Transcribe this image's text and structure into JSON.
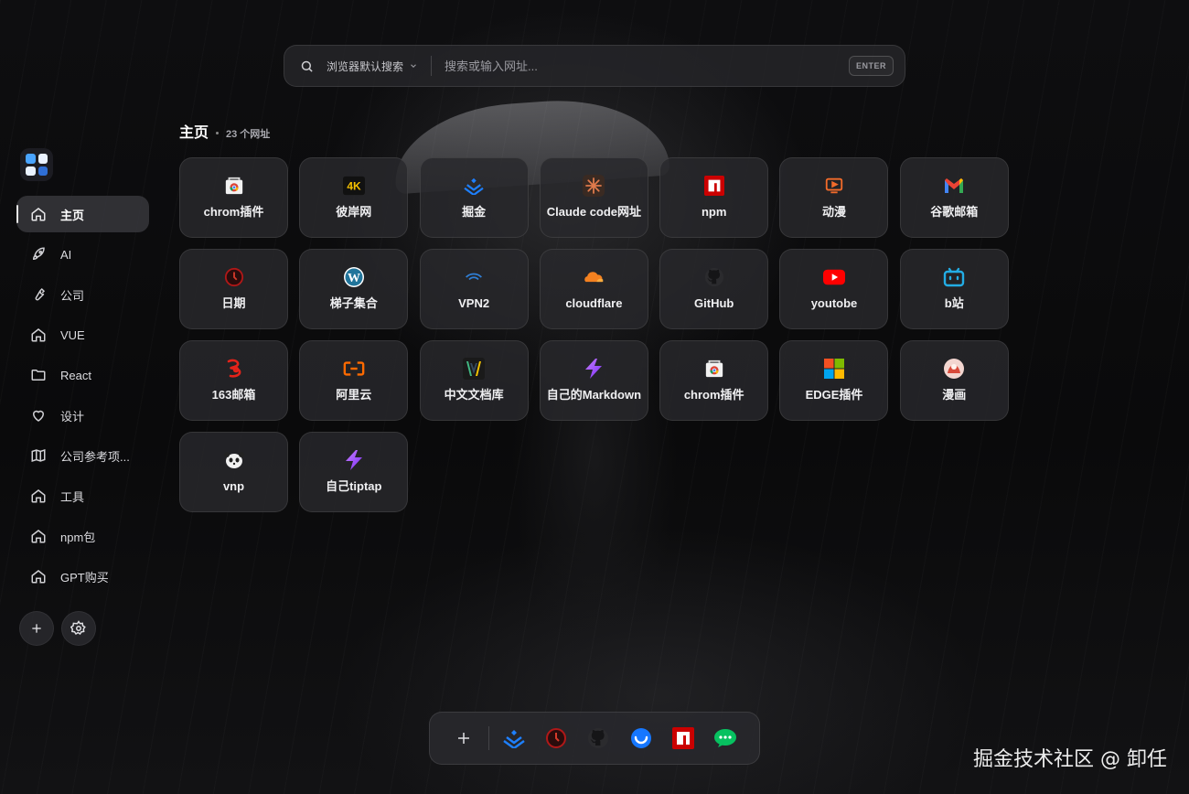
{
  "search": {
    "engine_label": "浏览器默认搜索",
    "placeholder": "搜索或输入网址...",
    "enter_key": "ENTER"
  },
  "sidebar": {
    "items": [
      {
        "label": "主页",
        "icon": "home-icon",
        "active": true
      },
      {
        "label": "AI",
        "icon": "rocket-icon"
      },
      {
        "label": "公司",
        "icon": "wrench-icon"
      },
      {
        "label": "VUE",
        "icon": "home-icon"
      },
      {
        "label": "React",
        "icon": "folder-icon"
      },
      {
        "label": "设计",
        "icon": "heart-icon"
      },
      {
        "label": "公司参考项...",
        "icon": "map-icon"
      },
      {
        "label": "工具",
        "icon": "home-icon"
      },
      {
        "label": "npm包",
        "icon": "home-icon"
      },
      {
        "label": "GPT购买",
        "icon": "home-icon"
      }
    ],
    "actions": [
      "plus-icon",
      "gear-icon"
    ]
  },
  "section": {
    "title": "主页",
    "count": "23 个网址"
  },
  "tiles": [
    {
      "label": "chrom插件",
      "icon": "chrome-store-icon"
    },
    {
      "label": "彼岸网",
      "icon": "4k-icon"
    },
    {
      "label": "掘金",
      "icon": "juejin-icon"
    },
    {
      "label": "Claude code网址",
      "icon": "claude-icon"
    },
    {
      "label": "npm",
      "icon": "npm-icon"
    },
    {
      "label": "动漫",
      "icon": "tv-play-icon"
    },
    {
      "label": "谷歌邮箱",
      "icon": "gmail-icon"
    },
    {
      "label": "日期",
      "icon": "clock-icon"
    },
    {
      "label": "梯子集合",
      "icon": "wordpress-icon"
    },
    {
      "label": "VPN2",
      "icon": "wifi-icon"
    },
    {
      "label": "cloudflare",
      "icon": "cloudflare-icon"
    },
    {
      "label": "GitHub",
      "icon": "github-icon"
    },
    {
      "label": "youtobe",
      "icon": "youtube-icon"
    },
    {
      "label": "b站",
      "icon": "bilibili-icon"
    },
    {
      "label": "163邮箱",
      "icon": "netease-icon"
    },
    {
      "label": "阿里云",
      "icon": "aliyun-icon"
    },
    {
      "label": "中文文档库",
      "icon": "vue-doc-icon"
    },
    {
      "label": "自己的Markdown",
      "icon": "bolt-icon"
    },
    {
      "label": "chrom插件",
      "icon": "chrome-store-icon"
    },
    {
      "label": "EDGE插件",
      "icon": "windows-icon"
    },
    {
      "label": "漫画",
      "icon": "manga-icon"
    },
    {
      "label": "vnp",
      "icon": "panda-icon"
    },
    {
      "label": "自己tiptap",
      "icon": "bolt-icon"
    }
  ],
  "dock": [
    "plus-icon",
    "juejin-icon",
    "clock-icon",
    "github-icon",
    "smile-icon",
    "npm-icon",
    "wechat-icon"
  ],
  "watermark": "掘金技术社区 @ 卸任",
  "colors": {
    "tile_bg": "#28282c",
    "accent_blue": "#1e80ff",
    "npm_red": "#cb0000"
  }
}
